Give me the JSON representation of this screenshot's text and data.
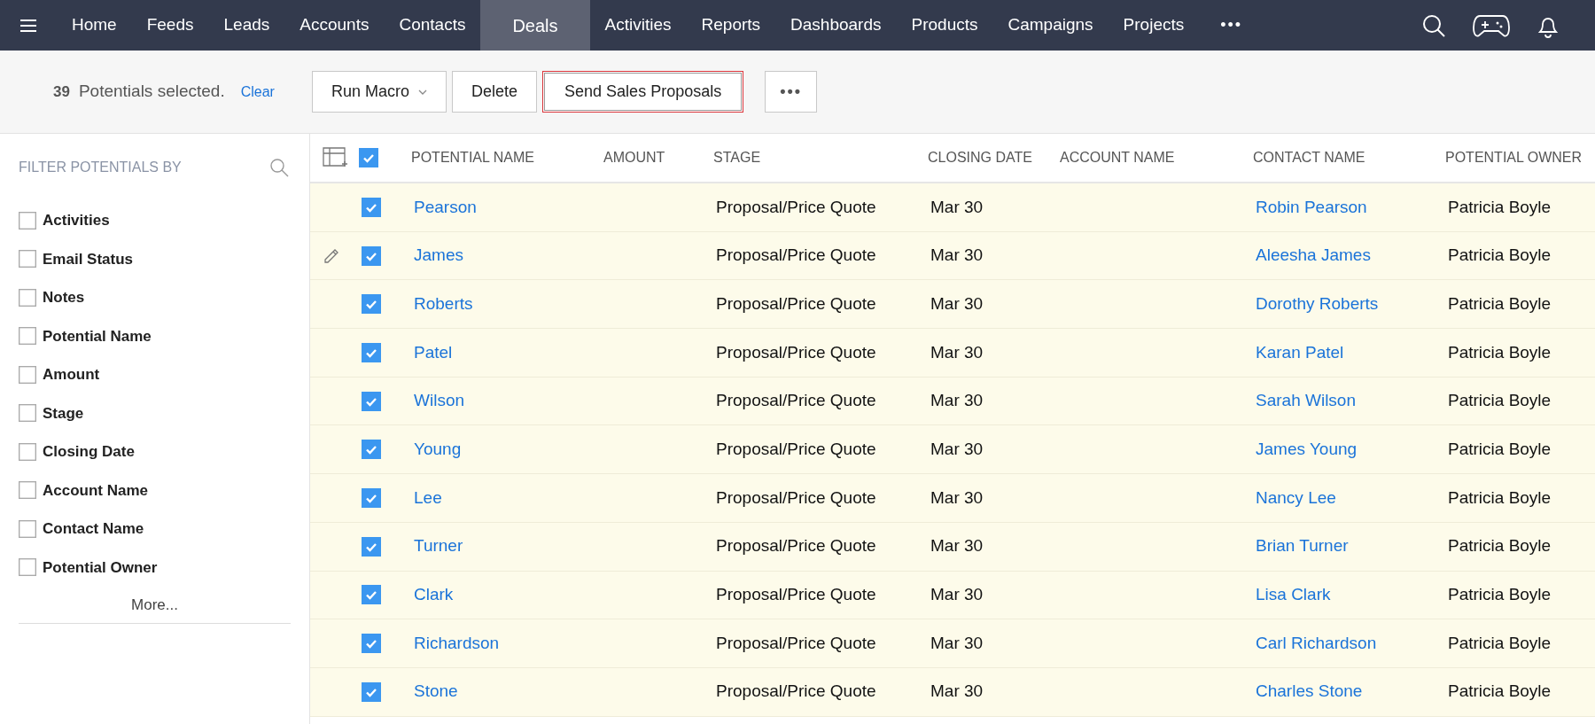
{
  "nav": {
    "items": [
      {
        "label": "Home",
        "selected": false
      },
      {
        "label": "Feeds",
        "selected": false
      },
      {
        "label": "Leads",
        "selected": false
      },
      {
        "label": "Accounts",
        "selected": false
      },
      {
        "label": "Contacts",
        "selected": false
      },
      {
        "label": "Deals",
        "selected": true
      },
      {
        "label": "Activities",
        "selected": false
      },
      {
        "label": "Reports",
        "selected": false
      },
      {
        "label": "Dashboards",
        "selected": false
      },
      {
        "label": "Products",
        "selected": false
      },
      {
        "label": "Campaigns",
        "selected": false
      },
      {
        "label": "Projects",
        "selected": false
      }
    ],
    "more": "•••"
  },
  "toolbar": {
    "count": "39",
    "selection_text": "Potentials selected.",
    "clear": "Clear",
    "buttons": [
      {
        "kind": "dropdown",
        "label": "Run Macro",
        "highlighted": false
      },
      {
        "kind": "plain",
        "label": "Delete",
        "highlighted": false
      },
      {
        "kind": "plain",
        "label": "Send Sales Proposals",
        "highlighted": true
      },
      {
        "kind": "more",
        "label": "•••",
        "highlighted": false
      }
    ]
  },
  "sidebar": {
    "title": "FILTER POTENTIALS BY",
    "filters": [
      {
        "label": "Activities",
        "checked": false
      },
      {
        "label": "Email Status",
        "checked": false
      },
      {
        "label": "Notes",
        "checked": false
      },
      {
        "label": "Potential Name",
        "checked": false
      },
      {
        "label": "Amount",
        "checked": false
      },
      {
        "label": "Stage",
        "checked": false
      },
      {
        "label": "Closing Date",
        "checked": false
      },
      {
        "label": "Account Name",
        "checked": false
      },
      {
        "label": "Contact Name",
        "checked": false
      },
      {
        "label": "Potential Owner",
        "checked": false
      }
    ],
    "more": "More..."
  },
  "table": {
    "all_checked": true,
    "columns": [
      "POTENTIAL NAME",
      "AMOUNT",
      "STAGE",
      "CLOSING DATE",
      "ACCOUNT NAME",
      "CONTACT NAME",
      "POTENTIAL OWNER"
    ],
    "rows": [
      {
        "checked": true,
        "editing": false,
        "potential_name": "Pearson",
        "stage": "Proposal/Price Quote",
        "closing_date": "Mar 30",
        "contact_name": "Robin Pearson",
        "owner": "Patricia Boyle"
      },
      {
        "checked": true,
        "editing": true,
        "potential_name": "James",
        "stage": "Proposal/Price Quote",
        "closing_date": "Mar 30",
        "contact_name": "Aleesha James",
        "owner": "Patricia Boyle"
      },
      {
        "checked": true,
        "editing": false,
        "potential_name": "Roberts",
        "stage": "Proposal/Price Quote",
        "closing_date": "Mar 30",
        "contact_name": "Dorothy Roberts",
        "owner": "Patricia Boyle"
      },
      {
        "checked": true,
        "editing": false,
        "potential_name": "Patel",
        "stage": "Proposal/Price Quote",
        "closing_date": "Mar 30",
        "contact_name": "Karan Patel",
        "owner": "Patricia Boyle"
      },
      {
        "checked": true,
        "editing": false,
        "potential_name": "Wilson",
        "stage": "Proposal/Price Quote",
        "closing_date": "Mar 30",
        "contact_name": "Sarah Wilson",
        "owner": "Patricia Boyle"
      },
      {
        "checked": true,
        "editing": false,
        "potential_name": "Young",
        "stage": "Proposal/Price Quote",
        "closing_date": "Mar 30",
        "contact_name": "James Young",
        "owner": "Patricia Boyle"
      },
      {
        "checked": true,
        "editing": false,
        "potential_name": "Lee",
        "stage": "Proposal/Price Quote",
        "closing_date": "Mar 30",
        "contact_name": "Nancy Lee",
        "owner": "Patricia Boyle"
      },
      {
        "checked": true,
        "editing": false,
        "potential_name": "Turner",
        "stage": "Proposal/Price Quote",
        "closing_date": "Mar 30",
        "contact_name": "Brian Turner",
        "owner": "Patricia Boyle"
      },
      {
        "checked": true,
        "editing": false,
        "potential_name": "Clark",
        "stage": "Proposal/Price Quote",
        "closing_date": "Mar 30",
        "contact_name": "Lisa Clark",
        "owner": "Patricia Boyle"
      },
      {
        "checked": true,
        "editing": false,
        "potential_name": "Richardson",
        "stage": "Proposal/Price Quote",
        "closing_date": "Mar 30",
        "contact_name": "Carl Richardson",
        "owner": "Patricia Boyle"
      },
      {
        "checked": true,
        "editing": false,
        "potential_name": "Stone",
        "stage": "Proposal/Price Quote",
        "closing_date": "Mar 30",
        "contact_name": "Charles Stone",
        "owner": "Patricia Boyle"
      }
    ]
  }
}
